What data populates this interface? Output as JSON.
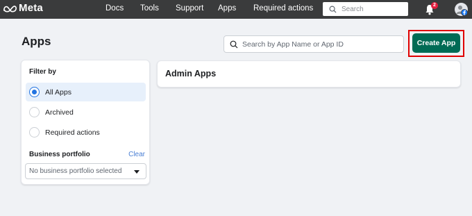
{
  "topbar": {
    "logo_text": "Meta",
    "nav": [
      "Docs",
      "Tools",
      "Support",
      "Apps",
      "Required actions"
    ],
    "search_placeholder": "Search",
    "notification_count": "2"
  },
  "page": {
    "title": "Apps",
    "app_search_placeholder": "Search by App Name or App ID",
    "create_button": "Create App"
  },
  "filter": {
    "title": "Filter by",
    "options": [
      {
        "label": "All Apps",
        "selected": true
      },
      {
        "label": "Archived",
        "selected": false
      },
      {
        "label": "Required actions",
        "selected": false
      }
    ],
    "business_portfolio_title": "Business portfolio",
    "clear_label": "Clear",
    "business_portfolio_value": "No business portfolio selected"
  },
  "admin_apps": {
    "title": "Admin Apps"
  },
  "colors": {
    "topbar": "#3a3b3c",
    "create_button": "#006b55",
    "highlight_border": "#e00000",
    "radio_accent": "#2374e1",
    "badge": "#e41e3f"
  }
}
